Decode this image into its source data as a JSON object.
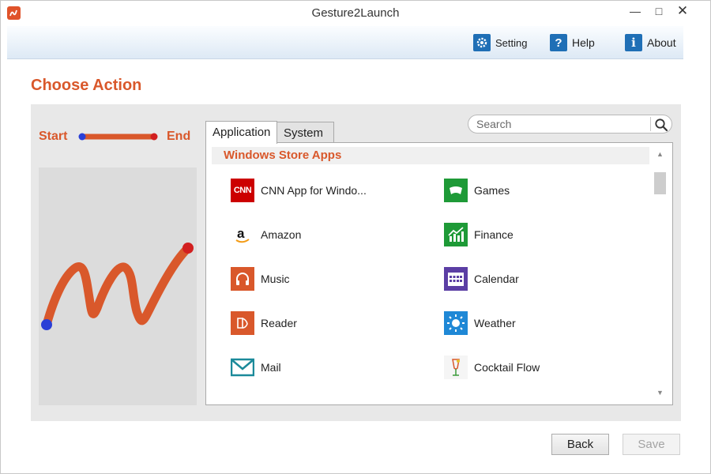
{
  "window": {
    "title": "Gesture2Launch"
  },
  "toolbar": {
    "setting_label": "Setting",
    "help_label": "Help",
    "about_label": "About"
  },
  "heading": "Choose Action",
  "gesture": {
    "start_label": "Start",
    "end_label": "End"
  },
  "tabs": [
    {
      "label": "Application",
      "active": true
    },
    {
      "label": "System",
      "active": false
    }
  ],
  "search": {
    "placeholder": "Search"
  },
  "section": {
    "title": "Windows Store Apps"
  },
  "apps": [
    {
      "name": "CNN App for Windo...",
      "icon": "cnn-icon"
    },
    {
      "name": "Games",
      "icon": "gamepad-icon"
    },
    {
      "name": "Amazon",
      "icon": "amazon-icon"
    },
    {
      "name": "Finance",
      "icon": "finance-chart-icon"
    },
    {
      "name": "Music",
      "icon": "headphones-icon"
    },
    {
      "name": "Calendar",
      "icon": "calendar-icon"
    },
    {
      "name": "Reader",
      "icon": "reader-icon"
    },
    {
      "name": "Weather",
      "icon": "sun-icon"
    },
    {
      "name": "Mail",
      "icon": "envelope-icon"
    },
    {
      "name": "Cocktail Flow",
      "icon": "cocktail-icon"
    }
  ],
  "buttons": {
    "back": "Back",
    "save": "Save"
  },
  "colors": {
    "accent": "#d9582b",
    "stroke_start": "#2a3fd6",
    "stroke_end": "#d21f1f",
    "toolbar_blue": "#1f6fb6"
  }
}
